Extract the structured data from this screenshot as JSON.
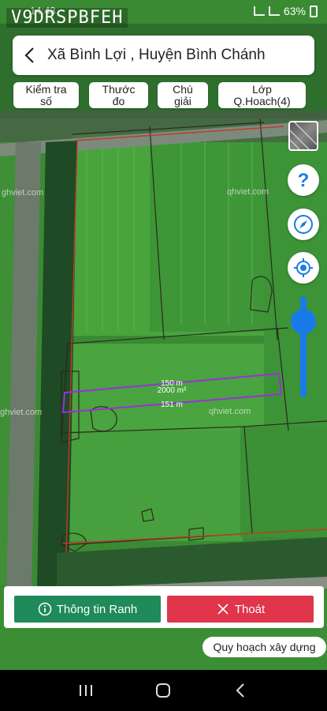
{
  "status_bar": {
    "time": "14:43",
    "watermark": "V9DRSPBFEH",
    "battery": "63%"
  },
  "header": {
    "title": "Xã Bình Lợi , Huyện Bình Chánh"
  },
  "tools": [
    {
      "line1": "Kiểm tra",
      "line2": "số"
    },
    {
      "line1": "Thước",
      "line2": "đo"
    },
    {
      "line1": "Chú",
      "line2": "giải"
    },
    {
      "line1": "Lớp",
      "line2": "Q.Hoach(4)"
    }
  ],
  "map": {
    "watermarks": [
      "ghviet.com",
      "qhviet.com",
      "ghviet.com",
      "qhviet.com"
    ],
    "plot": {
      "length_top": "150 m",
      "area": "2000 m²",
      "length_bottom": "151 m"
    }
  },
  "zoom": {
    "level": 0.25
  },
  "actions": {
    "info_label": "Thông tin Ranh",
    "exit_label": "Thoát",
    "plan_label": "Quy hoạch xây dựng"
  },
  "colors": {
    "info_green": "#1f8a5a",
    "exit_red": "#e0354b",
    "slider_blue": "#1a7be8",
    "plot_purple": "#9b30d8"
  }
}
